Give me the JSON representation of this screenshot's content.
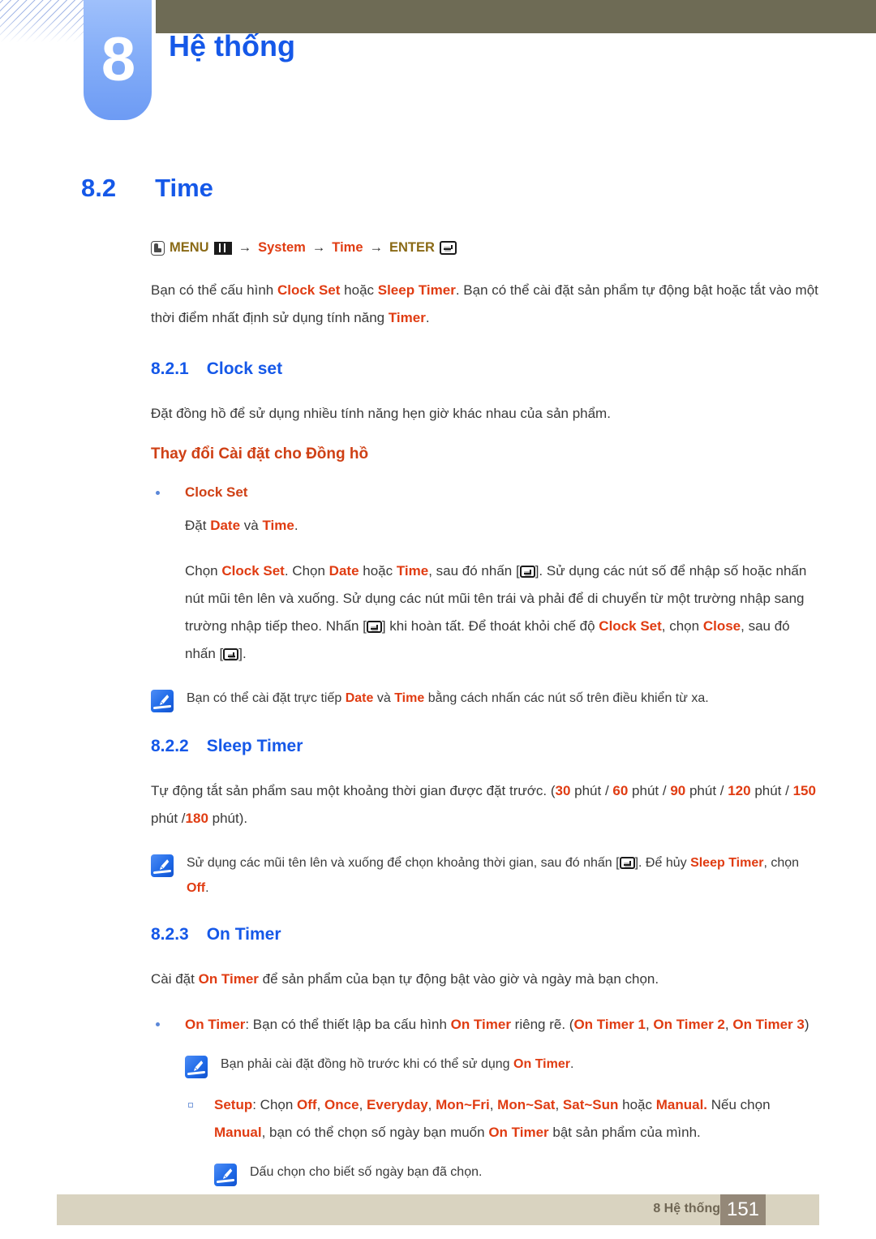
{
  "header": {
    "chapter_number": "8",
    "chapter_title": "Hệ thống"
  },
  "section": {
    "number": "8.2",
    "title": "Time"
  },
  "menu_path": {
    "menu_label": "MENU",
    "arrow1": "→",
    "item1": "System",
    "arrow2": "→",
    "item2": "Time",
    "arrow3": "→",
    "enter_label": "ENTER",
    "hand_icon": "hand-press-icon",
    "grid_icon": "menu-grid-icon",
    "enter_icon": "enter-key-icon"
  },
  "intro": {
    "t1": "Bạn có thể cấu hình ",
    "b1": "Clock Set",
    "t2": " hoặc ",
    "b2": "Sleep Timer",
    "t3": ". Bạn có thể cài đặt sản phẩm tự động bật hoặc tắt vào một thời điểm nhất định sử dụng tính năng ",
    "b3": "Timer",
    "t4": "."
  },
  "clock_set": {
    "number": "8.2.1",
    "title": "Clock set",
    "description": "Đặt đồng hồ để sử dụng nhiều tính năng hẹn giờ khác nhau của sản phẩm.",
    "subheading": "Thay đổi Cài đặt cho Đồng hồ",
    "bullet_label": "Clock Set",
    "line1_t1": "Đặt ",
    "line1_b1": "Date",
    "line1_t2": " và ",
    "line1_b2": "Time",
    "line1_t3": ".",
    "para_t1": "Chọn ",
    "para_b1": "Clock Set",
    "para_t2": ". Chọn ",
    "para_b2": "Date",
    "para_t3": " hoặc ",
    "para_b3": "Time",
    "para_t4": ", sau đó nhấn [",
    "para_t5": "]. Sử dụng các nút số để nhập số hoặc nhấn nút mũi tên lên và xuống. Sử dụng các nút mũi tên trái và phải để di chuyển từ một trường nhập sang trường nhập tiếp theo. Nhấn [",
    "para_t6": "] khi hoàn tất. Để thoát khỏi chế độ ",
    "para_b4": "Clock Set",
    "para_t7": ", chọn ",
    "para_b5": "Close",
    "para_t8": ", sau đó nhấn [",
    "para_t9": "].",
    "note_t1": "Bạn có thể cài đặt trực tiếp ",
    "note_b1": "Date",
    "note_t2": " và ",
    "note_b2": "Time",
    "note_t3": " bằng cách nhấn các nút số trên điều khiển từ xa."
  },
  "sleep_timer": {
    "number": "8.2.2",
    "title": "Sleep Timer",
    "p_t1": "Tự động tắt sản phẩm sau một khoảng thời gian được đặt trước. (",
    "v1": "30",
    "u1": " phút / ",
    "v2": "60",
    "u2": " phút / ",
    "v3": "90",
    "u3": " phút / ",
    "v4": "120",
    "u4": " phút / ",
    "v5": "150",
    "u5": " phút /",
    "v6": "180",
    "u6": " phút).",
    "note_t1": "Sử dụng các mũi tên lên và xuống để chọn khoảng thời gian, sau đó nhấn [",
    "note_t2": "]. Để hủy ",
    "note_b1": "Sleep Timer",
    "note_t3": ", chọn ",
    "note_b2": "Off",
    "note_t4": "."
  },
  "on_timer": {
    "number": "8.2.3",
    "title": "On Timer",
    "p_t1": "Cài đặt ",
    "p_b1": "On Timer",
    "p_t2": " để sản phẩm của bạn tự động bật vào giờ và ngày mà bạn chọn.",
    "bullet_b1": "On Timer",
    "bullet_t1": ": Bạn có thể thiết lập ba cấu hình ",
    "bullet_b2": "On Timer",
    "bullet_t2": " riêng rẽ. (",
    "bullet_b3": "On Timer 1",
    "bullet_t3": ", ",
    "bullet_b4": "On Timer 2",
    "bullet_t4": ", ",
    "bullet_b5": "On Timer 3",
    "bullet_t5": ")",
    "note1_t1": "Bạn phải cài đặt đồng hồ trước khi có thể sử dụng ",
    "note1_b1": "On Timer",
    "note1_t2": ".",
    "setup_b1": "Setup",
    "setup_t1": ": Chọn ",
    "setup_b2": "Off",
    "setup_t2": ", ",
    "setup_b3": "Once",
    "setup_t3": ", ",
    "setup_b4": "Everyday",
    "setup_t4": ", ",
    "setup_b5": "Mon~Fri",
    "setup_t5": ", ",
    "setup_b6": "Mon~Sat",
    "setup_t6": ", ",
    "setup_b7": "Sat~Sun",
    "setup_t7": " hoặc ",
    "setup_b8": "Manual.",
    "setup_t8": " Nếu chọn ",
    "setup_b9": "Manual",
    "setup_t9": ", bạn có thể chọn số ngày bạn muốn ",
    "setup_b10": "On Timer",
    "setup_t10": " bật sản phẩm của mình.",
    "note2_t1": "Dấu chọn cho biết số ngày bạn đã chọn."
  },
  "footer": {
    "label": "8 Hệ thống",
    "page": "151"
  },
  "colors": {
    "blue_heading": "#1558e8",
    "red_term": "#e03c12",
    "orange_heading": "#cf4015",
    "gold": "#8a6a16",
    "olive_bar": "#6e6b55",
    "footer_bar": "#d9d3c0",
    "footer_page_box": "#948878",
    "chapter_tab": "#85aef8"
  }
}
